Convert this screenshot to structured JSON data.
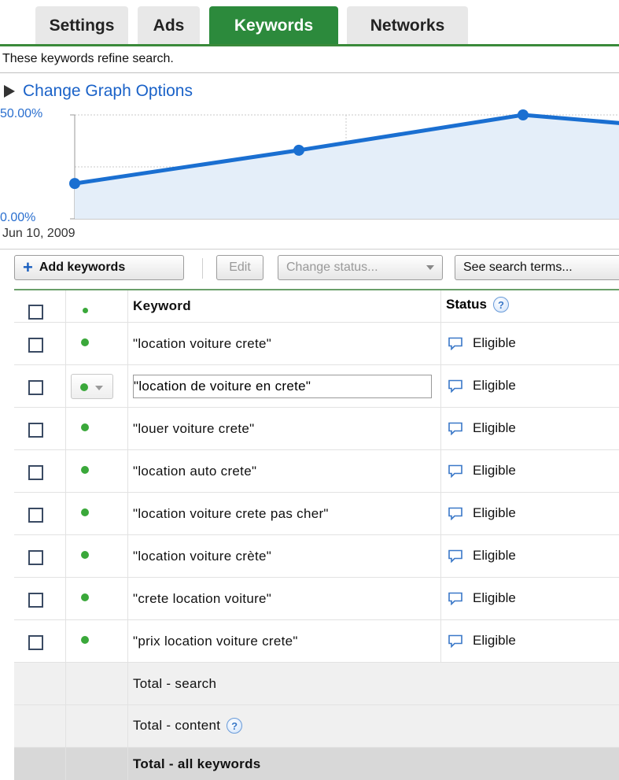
{
  "tabs": [
    {
      "label": "Settings",
      "active": false
    },
    {
      "label": "Ads",
      "active": false
    },
    {
      "label": "Keywords",
      "active": true
    },
    {
      "label": "Networks",
      "active": false
    }
  ],
  "subtitle": "These keywords refine search.",
  "graph_options_label": "Change Graph Options",
  "chart_data": {
    "type": "area",
    "x": [
      "Jun 10, 2009",
      "",
      "",
      ""
    ],
    "y_tick_labels": [
      "50.00%",
      "0.00%"
    ],
    "ylim": [
      0,
      50
    ],
    "x_first_label": "Jun 10, 2009",
    "series": [
      {
        "values": [
          17,
          33,
          50,
          46
        ]
      }
    ],
    "grid": true,
    "colors": {
      "line": "#1a6fd1",
      "fill": "#e4eef9",
      "axis_label": "#2a6fcf"
    }
  },
  "toolbar": {
    "add_keywords": "Add keywords",
    "edit": "Edit",
    "change_status": "Change status...",
    "see_search_terms": "See search terms..."
  },
  "table": {
    "header": {
      "keyword": "Keyword",
      "status": "Status"
    },
    "rows": [
      {
        "keyword": "\"location voiture crete\"",
        "status": "Eligible"
      },
      {
        "keyword": "\"location de voiture en crete\"",
        "status": "Eligible"
      },
      {
        "keyword": "\"louer voiture crete\"",
        "status": "Eligible"
      },
      {
        "keyword": "\"location auto crete\"",
        "status": "Eligible"
      },
      {
        "keyword": "\"location voiture crete pas cher\"",
        "status": "Eligible"
      },
      {
        "keyword": "\"location voiture crète\"",
        "status": "Eligible"
      },
      {
        "keyword": "\"crete location voiture\"",
        "status": "Eligible"
      },
      {
        "keyword": "\"prix location voiture crete\"",
        "status": "Eligible"
      }
    ],
    "totals": {
      "search": "Total - search",
      "content": "Total - content",
      "all": "Total - all keywords"
    }
  },
  "colors": {
    "accent": "#2c8a3c",
    "link": "#1a62c8",
    "status_dot": "#3aa83a"
  }
}
